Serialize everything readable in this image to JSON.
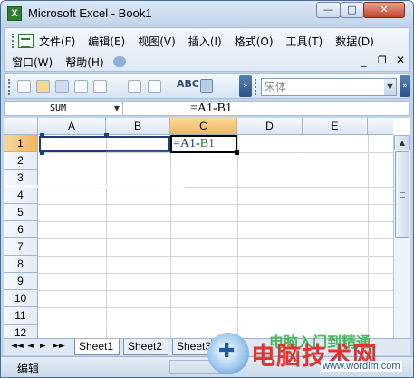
{
  "window": {
    "title": "Microsoft Excel - Book1",
    "app_icon": "X",
    "controls": {
      "minimize": "—",
      "maximize": "□",
      "close": "✕"
    }
  },
  "menubar": {
    "items": [
      "文件(F)",
      "编辑(E)",
      "视图(V)",
      "插入(I)",
      "格式(O)",
      "工具(T)",
      "数据(D)"
    ],
    "items_row2": [
      "窗口(W)",
      "帮助(H)"
    ],
    "doc_controls": {
      "minimize": "_",
      "restore": "❐",
      "close": "✕"
    }
  },
  "toolbar": {
    "font_name": "宋体",
    "spell_label": "ABC"
  },
  "formula_bar": {
    "name_box": "SUM",
    "formula": "=A1-B1"
  },
  "sheet": {
    "columns": [
      "A",
      "B",
      "C",
      "D",
      "E"
    ],
    "selected_column": "C",
    "rows": [
      "1",
      "2",
      "3",
      "4",
      "5",
      "6",
      "7",
      "8",
      "9",
      "10",
      "11",
      "12"
    ],
    "selected_row": "1",
    "active_cell": "C1",
    "cell_c1_parts": {
      "eq": "=",
      "a1": "A1",
      "op": "-",
      "b1": "B1"
    },
    "colors": {
      "ref_a1": "#1f3d7a",
      "ref_b1": "#2e7d32",
      "selected_header": "#f4b860"
    }
  },
  "tabs": {
    "nav": [
      "◄◄",
      "◄",
      "►",
      "►►"
    ],
    "sheets": [
      "Sheet1",
      "Sheet2",
      "Sheet3"
    ]
  },
  "status": {
    "mode": "编辑"
  },
  "watermark": {
    "green_text": "电脑入门到精通",
    "red_text": "电脑技术网",
    "url": "www.wordlm.com"
  }
}
